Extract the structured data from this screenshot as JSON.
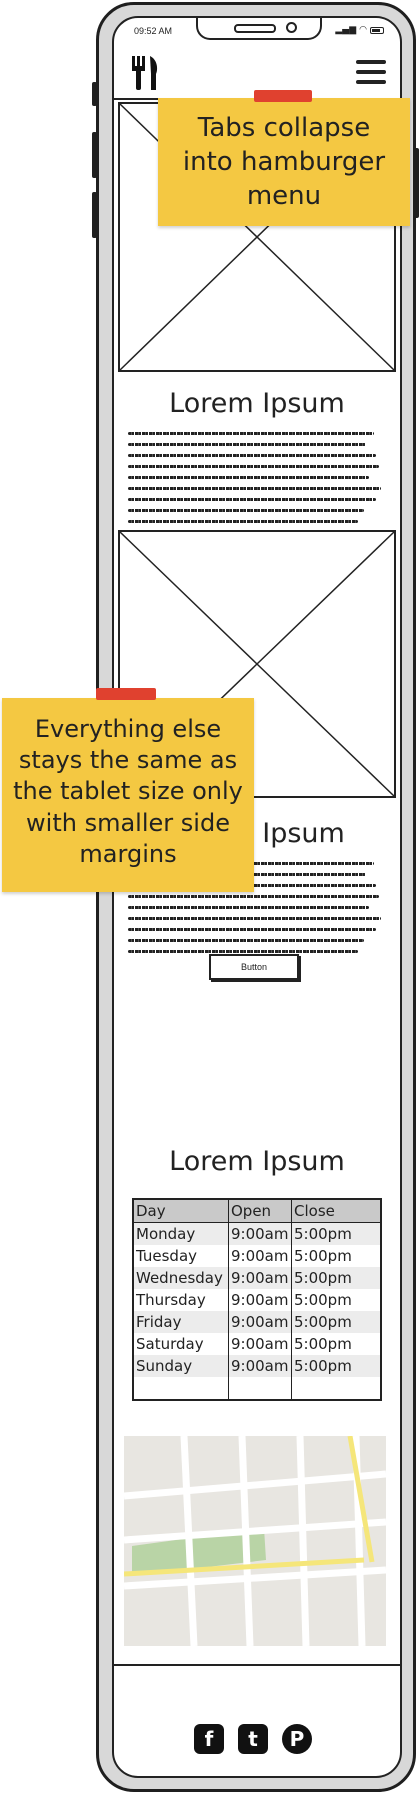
{
  "status_bar": {
    "time": "09:52 AM",
    "signal": "▂▄▆",
    "wifi": "◠"
  },
  "header": {
    "logo_icon": "fork-knife-icon",
    "menu_icon": "hamburger-menu-icon"
  },
  "sections": [
    {
      "title": "Lorem Ipsum"
    },
    {
      "title": "Lorem Ipsum",
      "button_label": "Button"
    },
    {
      "title": "Lorem Ipsum"
    }
  ],
  "hours": {
    "columns": [
      "Day",
      "Open",
      "Close"
    ],
    "rows": [
      [
        "Monday",
        "9:00am",
        "5:00pm"
      ],
      [
        "Tuesday",
        "9:00am",
        "5:00pm"
      ],
      [
        "Wednesday",
        "9:00am",
        "5:00pm"
      ],
      [
        "Thursday",
        "9:00am",
        "5:00pm"
      ],
      [
        "Friday",
        "9:00am",
        "5:00pm"
      ],
      [
        "Saturday",
        "9:00am",
        "5:00pm"
      ],
      [
        "Sunday",
        "9:00am",
        "5:00pm"
      ]
    ]
  },
  "footer": {
    "social": [
      "facebook-icon",
      "twitter-icon",
      "pinterest-icon"
    ],
    "social_glyphs": [
      "f",
      "t",
      "P"
    ]
  },
  "notes": {
    "top": "Tabs collapse into hamburger menu",
    "middle": "Everything else stays the same as the tablet size only with smaller side margins"
  },
  "colors": {
    "sticky": "#f4c842",
    "tape": "#e0412f",
    "map_bg": "#e8e6e1",
    "map_park": "#b9d4a6",
    "map_road_major": "#f5e67a"
  }
}
